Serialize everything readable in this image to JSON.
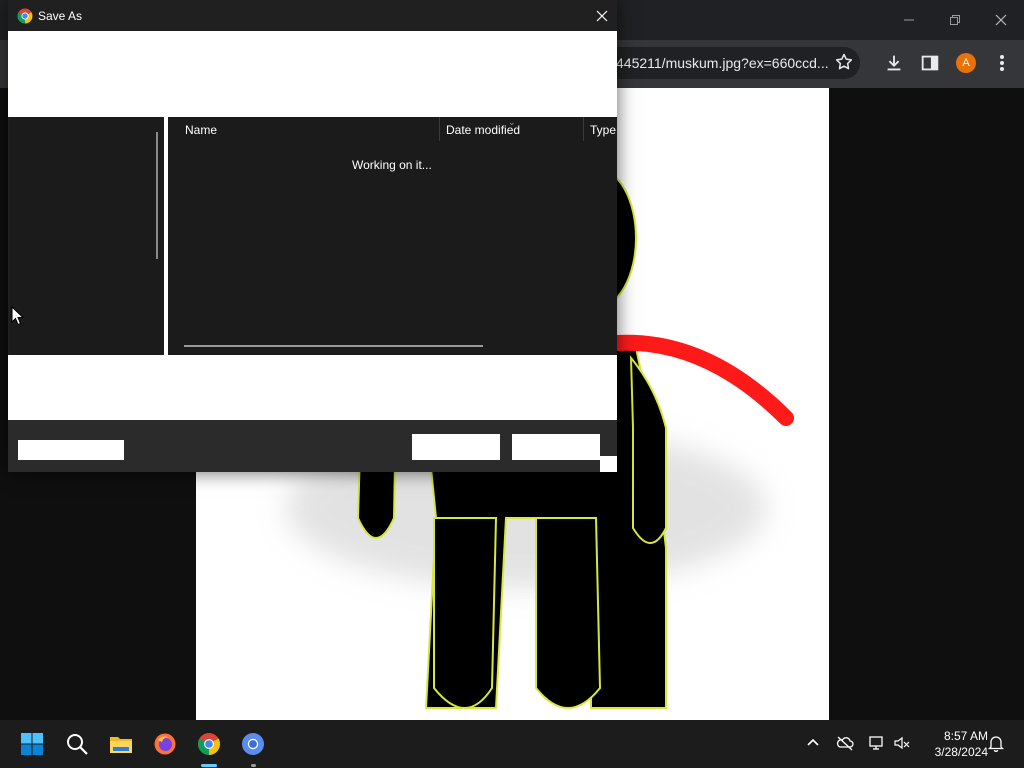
{
  "browser": {
    "url_text": "445211/muskum.jpg?ex=660ccd...",
    "profile_initial": "A",
    "colors": {
      "toolbar": "#35363a",
      "avatar": "#e8710a",
      "page_bg": "#ffffff"
    }
  },
  "dialog": {
    "title": "Save As",
    "columns": {
      "name": "Name",
      "date_modified": "Date modified",
      "type": "Type"
    },
    "status_text": "Working on it..."
  },
  "taskbar": {
    "time": "8:57 AM",
    "date": "3/28/2024",
    "apps": [
      "windows-start",
      "search",
      "file-explorer",
      "firefox",
      "chrome",
      "chrome-secondary"
    ]
  }
}
